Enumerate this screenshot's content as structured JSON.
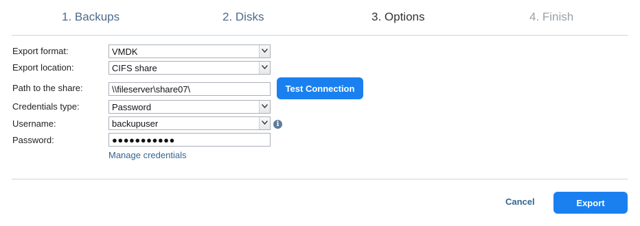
{
  "wizard": {
    "steps": [
      {
        "label": "1. Backups",
        "state": "done"
      },
      {
        "label": "2. Disks",
        "state": "done"
      },
      {
        "label": "3. Options",
        "state": "current"
      },
      {
        "label": "4. Finish",
        "state": "todo"
      }
    ]
  },
  "form": {
    "export_format": {
      "label": "Export format:",
      "value": "VMDK"
    },
    "export_location": {
      "label": "Export location:",
      "value": "CIFS share"
    },
    "share_path": {
      "label": "Path to the share:",
      "value": "\\\\fileserver\\share07\\"
    },
    "credentials_type": {
      "label": "Credentials type:",
      "value": "Password"
    },
    "username": {
      "label": "Username:",
      "value": "backupuser"
    },
    "password": {
      "label": "Password:",
      "value": "●●●●●●●●●●●"
    },
    "manage_credentials": "Manage credentials",
    "test_connection": "Test Connection",
    "info_glyph": "i"
  },
  "footer": {
    "cancel": "Cancel",
    "export": "Export"
  },
  "colors": {
    "primary": "#1a80f0",
    "link": "#34648f",
    "step_done": "#4a6a8c",
    "step_todo": "#9aa0a6"
  }
}
